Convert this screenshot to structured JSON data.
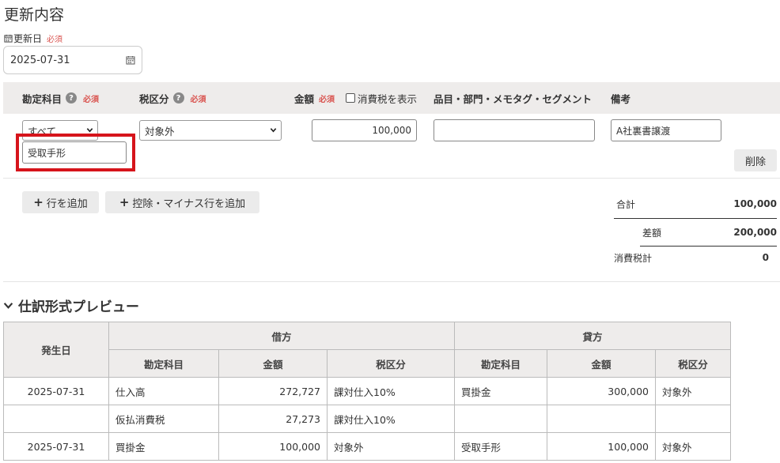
{
  "page_title": "更新内容",
  "date_field": {
    "label": "更新日",
    "required": "必須",
    "value": "2025-07-31",
    "icon": "calendar-icon"
  },
  "entry_header": {
    "account": "勘定科目",
    "account_required": "必須",
    "tax": "税区分",
    "tax_required": "必須",
    "amount": "金額",
    "amount_required": "必須",
    "show_tax": "消費税を表示",
    "item": "品目・部門・メモタグ・セグメント",
    "memo": "備考"
  },
  "entry_row": {
    "account_filter": "すべて",
    "account_value": "受取手形",
    "tax_value": "対象外",
    "amount_value": "100,000",
    "item_value": "",
    "memo_value": "A社裏書譲渡",
    "delete_label": "削除"
  },
  "actions": {
    "add_row": "行を追加",
    "add_deduction_row": "控除・マイナス行を追加"
  },
  "totals": {
    "total_label": "合計",
    "total_value": "100,000",
    "diff_label": "差額",
    "diff_value": "200,000",
    "tax_label": "消費税計",
    "tax_value": "0"
  },
  "preview": {
    "title": "仕訳形式プレビュー",
    "header_date": "発生日",
    "debit": "借方",
    "credit": "貸方",
    "col_account": "勘定科目",
    "col_amount": "金額",
    "col_tax": "税区分",
    "rows": [
      {
        "date": "2025-07-31",
        "d_account": "仕入高",
        "d_amount": "272,727",
        "d_tax": "課対仕入10%",
        "c_account": "買掛金",
        "c_amount": "300,000",
        "c_tax": "対象外"
      },
      {
        "date": "",
        "d_account": "仮払消費税",
        "d_amount": "27,273",
        "d_tax": "課対仕入10%",
        "c_account": "",
        "c_amount": "",
        "c_tax": ""
      },
      {
        "date": "2025-07-31",
        "d_account": "買掛金",
        "d_amount": "100,000",
        "d_tax": "対象外",
        "c_account": "受取手形",
        "c_amount": "100,000",
        "c_tax": "対象外"
      }
    ]
  },
  "colors": {
    "required": "#d9534f",
    "highlight": "#d6141b",
    "header_bg": "#eeeceb"
  }
}
